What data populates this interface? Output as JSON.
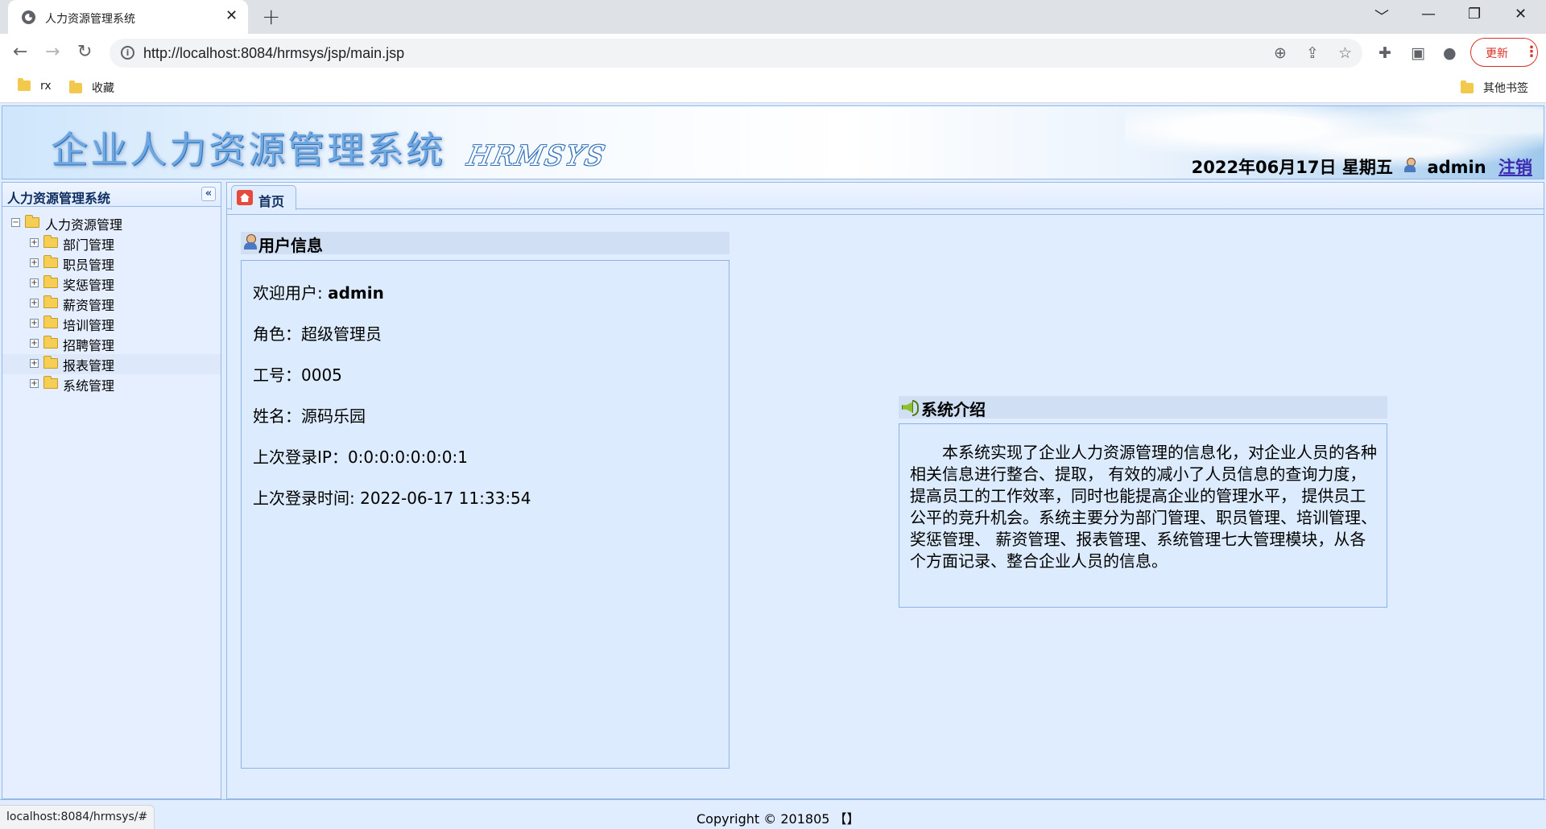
{
  "browser": {
    "tab_title": "人力资源管理系统",
    "tab_close": "✕",
    "new_tab": "+",
    "url": "http://localhost:8084/hrmsys/jsp/main.jsp",
    "update_label": "更新",
    "update_menu": "⋮",
    "window_controls": [
      "﹀",
      "—",
      "❐",
      "✕"
    ],
    "bookmarks": [
      "rx",
      "收藏"
    ],
    "other_bookmarks": "其他书签",
    "status_url": "localhost:8084/hrmsys/#"
  },
  "header": {
    "system_title": "企业人力资源管理系统",
    "system_subtitle": "HRMSYS",
    "date": "2022年06月17日 星期五",
    "user": "admin",
    "logout": "注销"
  },
  "sidebar": {
    "title": "人力资源管理系统",
    "collapse": "«",
    "root": "人力资源管理",
    "items": [
      {
        "label": "部门管理"
      },
      {
        "label": "职员管理"
      },
      {
        "label": "奖惩管理"
      },
      {
        "label": "薪资管理"
      },
      {
        "label": "培训管理"
      },
      {
        "label": "招聘管理"
      },
      {
        "label": "报表管理"
      },
      {
        "label": "系统管理"
      }
    ],
    "selected_index": 6
  },
  "tabs": [
    {
      "label": "首页"
    }
  ],
  "user_info": {
    "title": "用户信息",
    "welcome_label": "欢迎用户: ",
    "welcome_value": "admin",
    "role": "角色：超级管理员",
    "employee_id": "工号：0005",
    "name": "姓名：源码乐园",
    "last_ip": "上次登录IP：0:0:0:0:0:0:0:1",
    "last_time": "上次登录时间: 2022-06-17 11:33:54"
  },
  "intro": {
    "title": "系统介绍",
    "text": "本系统实现了企业人力资源管理的信息化，对企业人员的各种相关信息进行整合、提取， 有效的减小了人员信息的查询力度，提高员工的工作效率，同时也能提高企业的管理水平， 提供员工公平的竞升机会。系统主要分为部门管理、职员管理、培训管理、奖惩管理、 薪资管理、报表管理、系统管理七大管理模块，从各个方面记录、整合企业人员的信息。"
  },
  "footer": {
    "copyright": "Copyright © 201805 【】"
  },
  "colors": {
    "panel_bg": "#e0ecff",
    "border": "#95b8e7",
    "title_text": "#0e2d5f",
    "logout_link": "#3b2bb0",
    "update_red": "#d93025"
  }
}
